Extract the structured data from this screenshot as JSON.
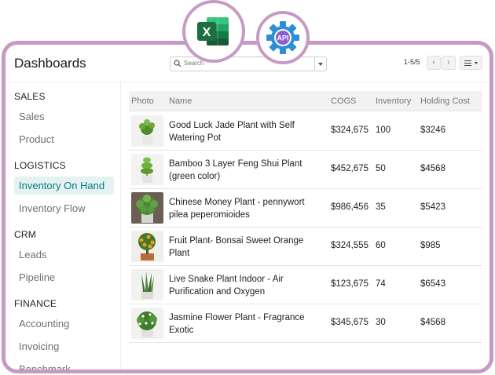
{
  "header": {
    "title": "Dashboards",
    "search_placeholder": "Search",
    "pager": "1-5/5",
    "prev": "‹",
    "next": "›"
  },
  "badges": {
    "api_label": "API",
    "excel_letter": "X"
  },
  "sidebar": {
    "sections": [
      {
        "label": "SALES",
        "items": [
          "Sales",
          "Product"
        ]
      },
      {
        "label": "LOGISTICS",
        "items": [
          "Inventory On Hand",
          "Inventory Flow"
        ]
      },
      {
        "label": "CRM",
        "items": [
          "Leads",
          "Pipeline"
        ]
      },
      {
        "label": "FINANCE",
        "items": [
          "Accounting",
          "Invoicing",
          "Benchmark"
        ]
      }
    ],
    "active_item": "Inventory On Hand"
  },
  "table": {
    "columns": [
      "Photo",
      "Name",
      "COGS",
      "Inventory",
      "Holding Cost"
    ],
    "rows": [
      {
        "name": "Good Luck Jade Plant with Self Watering Pot",
        "cogs": "$324,675",
        "inventory": "100",
        "holding": "$3246"
      },
      {
        "name": "Bamboo 3 Layer Feng Shui Plant (green color)",
        "cogs": "$452,675",
        "inventory": "50",
        "holding": "$4568"
      },
      {
        "name": "Chinese Money Plant - pennywort pilea peperomioides",
        "cogs": "$986,456",
        "inventory": "35",
        "holding": "$5423"
      },
      {
        "name": "Fruit Plant- Bonsai Sweet Orange Plant",
        "cogs": "$324,555",
        "inventory": "60",
        "holding": "$985"
      },
      {
        "name": "Live Snake Plant Indoor - Air Purification and Oxygen",
        "cogs": "$123,675",
        "inventory": "74",
        "holding": "$6543"
      },
      {
        "name": "Jasmine Flower Plant - Fragrance Exotic",
        "cogs": "$345,675",
        "inventory": "30",
        "holding": "$4568"
      }
    ]
  },
  "colors": {
    "frame": "#c69bc3",
    "accent": "#017e84",
    "active_bg": "#e5f2f2",
    "excel_green": "#1d6f42",
    "api_blue": "#2b8fd6"
  }
}
